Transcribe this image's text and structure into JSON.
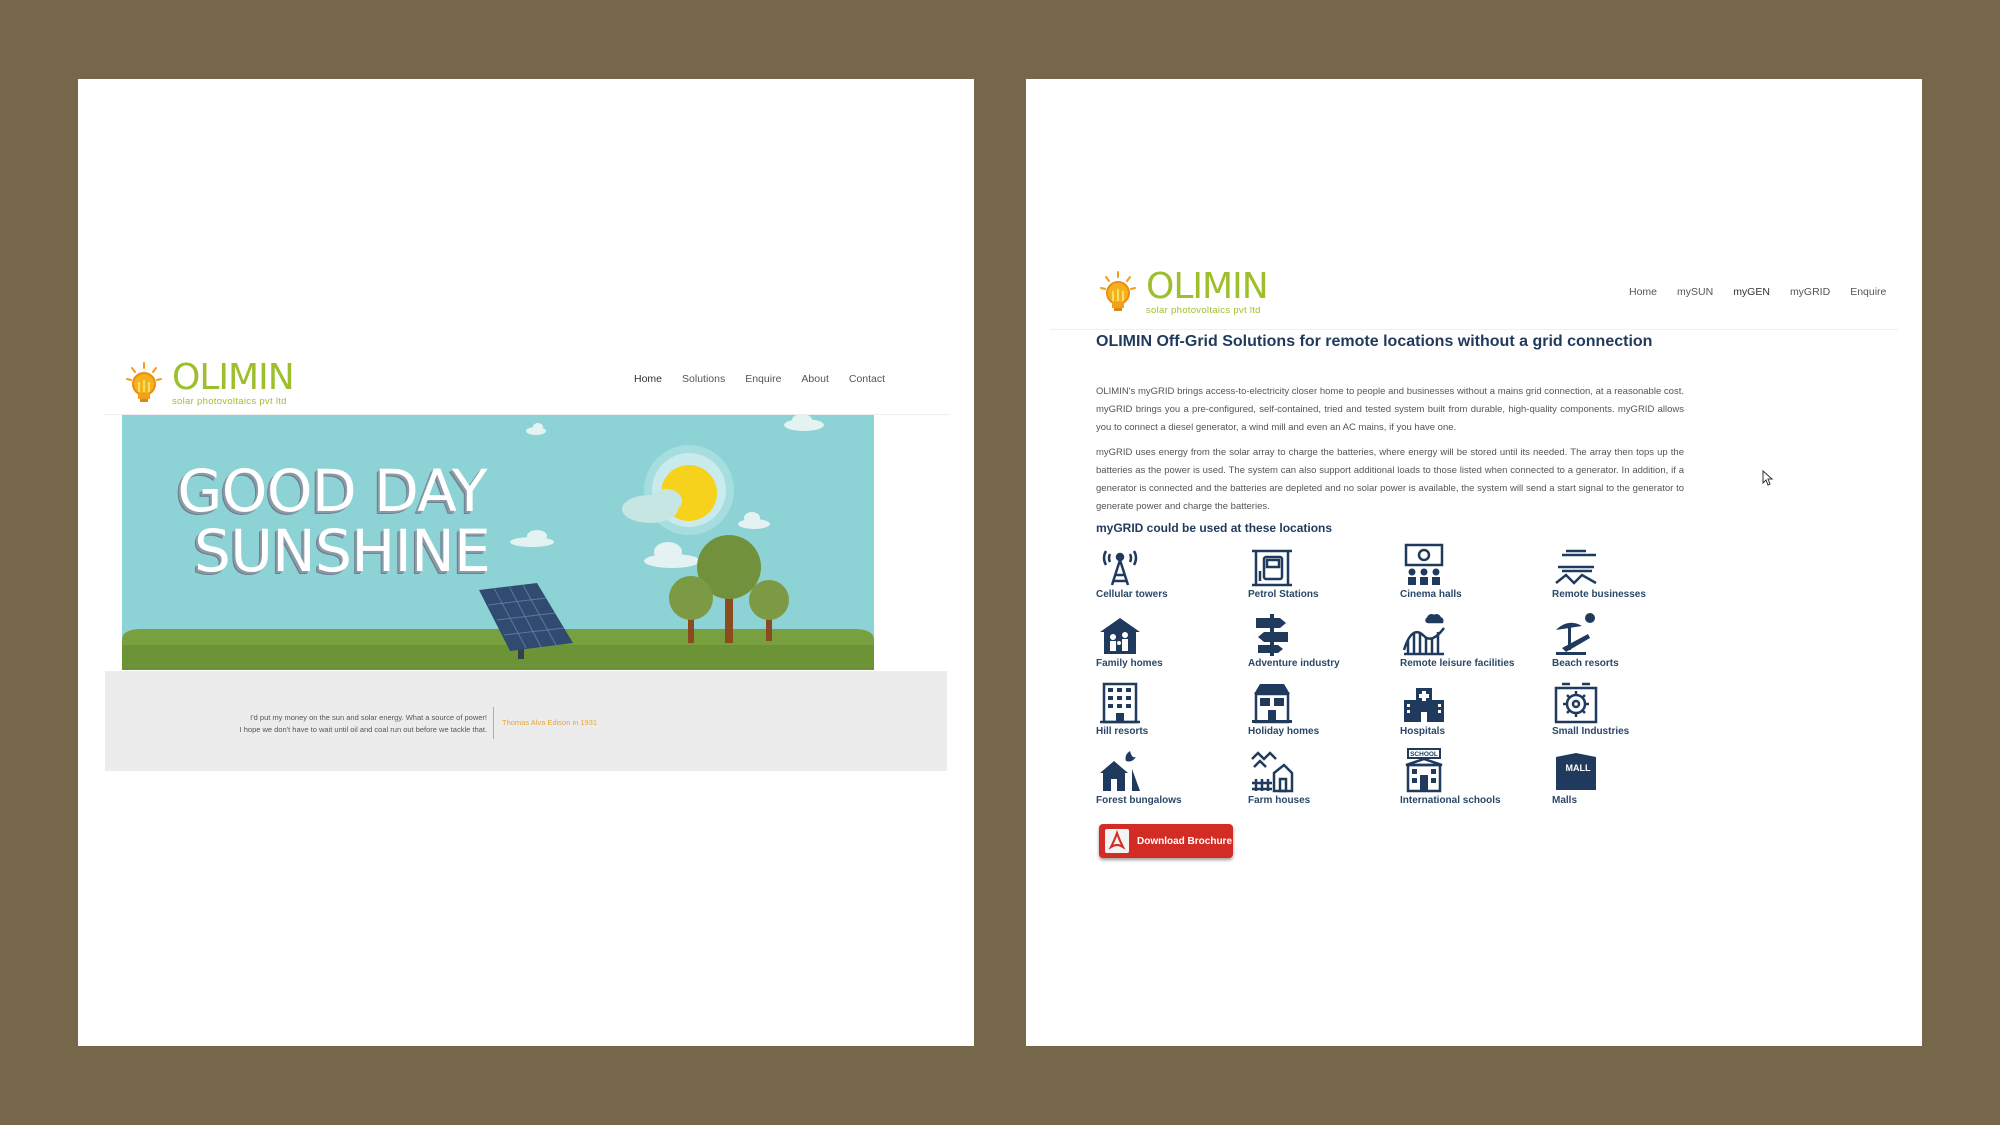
{
  "left_page": {
    "logo": {
      "word": "OLIMIN",
      "tagline": "solar photovoltaics pvt ltd"
    },
    "nav": [
      {
        "label": "Home",
        "active": true
      },
      {
        "label": "Solutions",
        "active": false
      },
      {
        "label": "Enquire",
        "active": false
      },
      {
        "label": "About",
        "active": false
      },
      {
        "label": "Contact",
        "active": false
      }
    ],
    "hero": {
      "line1": "GOOD DAY",
      "line2": "SUNSHINE"
    },
    "quote": {
      "line1": "I'd put my money on the sun and solar energy. What a source of power!",
      "line2": "I hope we don't have to wait until oil and coal run out before we tackle that.",
      "author": "Thomas Alva Edison in 1931"
    }
  },
  "right_page": {
    "logo": {
      "word": "OLIMIN",
      "tagline": "solar photovoltaics pvt ltd"
    },
    "nav": [
      {
        "label": "Home",
        "active": false
      },
      {
        "label": "mySUN",
        "active": false
      },
      {
        "label": "myGEN",
        "active": true
      },
      {
        "label": "myGRID",
        "active": false
      },
      {
        "label": "Enquire",
        "active": false
      }
    ],
    "title": "OLIMIN Off-Grid Solutions for remote locations without a grid connection",
    "paragraph1": "OLIMIN's myGRID brings access-to-electricity closer home to people and businesses without a mains grid connection, at a reasonable cost. myGRID brings you a pre-configured, self-contained, tried and tested system built from durable, high-quality components. myGRID allows you to connect a diesel generator, a wind mill and even an AC mains, if you have one.",
    "paragraph2": "myGRID uses energy from the solar array to charge the batteries, where energy will be stored until its needed. The array then tops up the batteries as the power is used. The system can also support additional loads to those listed when connected to a generator. In addition, if a generator is connected and the batteries are depleted and no solar power is available, the system will send a start signal to the generator to generate power and charge the batteries.",
    "locations_title": "myGRID could be used at these locations",
    "locations": [
      {
        "label": "Cellular towers",
        "icon": "tower-icon"
      },
      {
        "label": "Petrol Stations",
        "icon": "petrol-station-icon"
      },
      {
        "label": "Cinema halls",
        "icon": "cinema-icon"
      },
      {
        "label": "Remote businesses",
        "icon": "remote-business-icon"
      },
      {
        "label": "Family homes",
        "icon": "family-home-icon"
      },
      {
        "label": "Adventure industry",
        "icon": "signpost-icon"
      },
      {
        "label": "Remote leisure facilities",
        "icon": "leisure-icon"
      },
      {
        "label": "Beach resorts",
        "icon": "beach-icon"
      },
      {
        "label": "Hill resorts",
        "icon": "hotel-icon"
      },
      {
        "label": "Holiday homes",
        "icon": "holiday-home-icon"
      },
      {
        "label": "Hospitals",
        "icon": "hospital-icon"
      },
      {
        "label": "Small Industries",
        "icon": "industry-gear-icon"
      },
      {
        "label": "Forest bungalows",
        "icon": "bungalow-icon"
      },
      {
        "label": "Farm houses",
        "icon": "farm-house-icon"
      },
      {
        "label": "International schools",
        "icon": "school-icon"
      },
      {
        "label": "Malls",
        "icon": "mall-icon"
      }
    ],
    "brochure_button": "Download Brochure",
    "school_sign": "SCHOOL",
    "mall_sign": "MALL"
  },
  "colors": {
    "backdrop": "#76664a",
    "logo_green": "#9dbf2d",
    "accent_orange": "#e8a537",
    "navy": "#1f3a5c",
    "sky": "#8dd2d5",
    "grass": "#78a03e",
    "brochure_red": "#d22c25"
  }
}
